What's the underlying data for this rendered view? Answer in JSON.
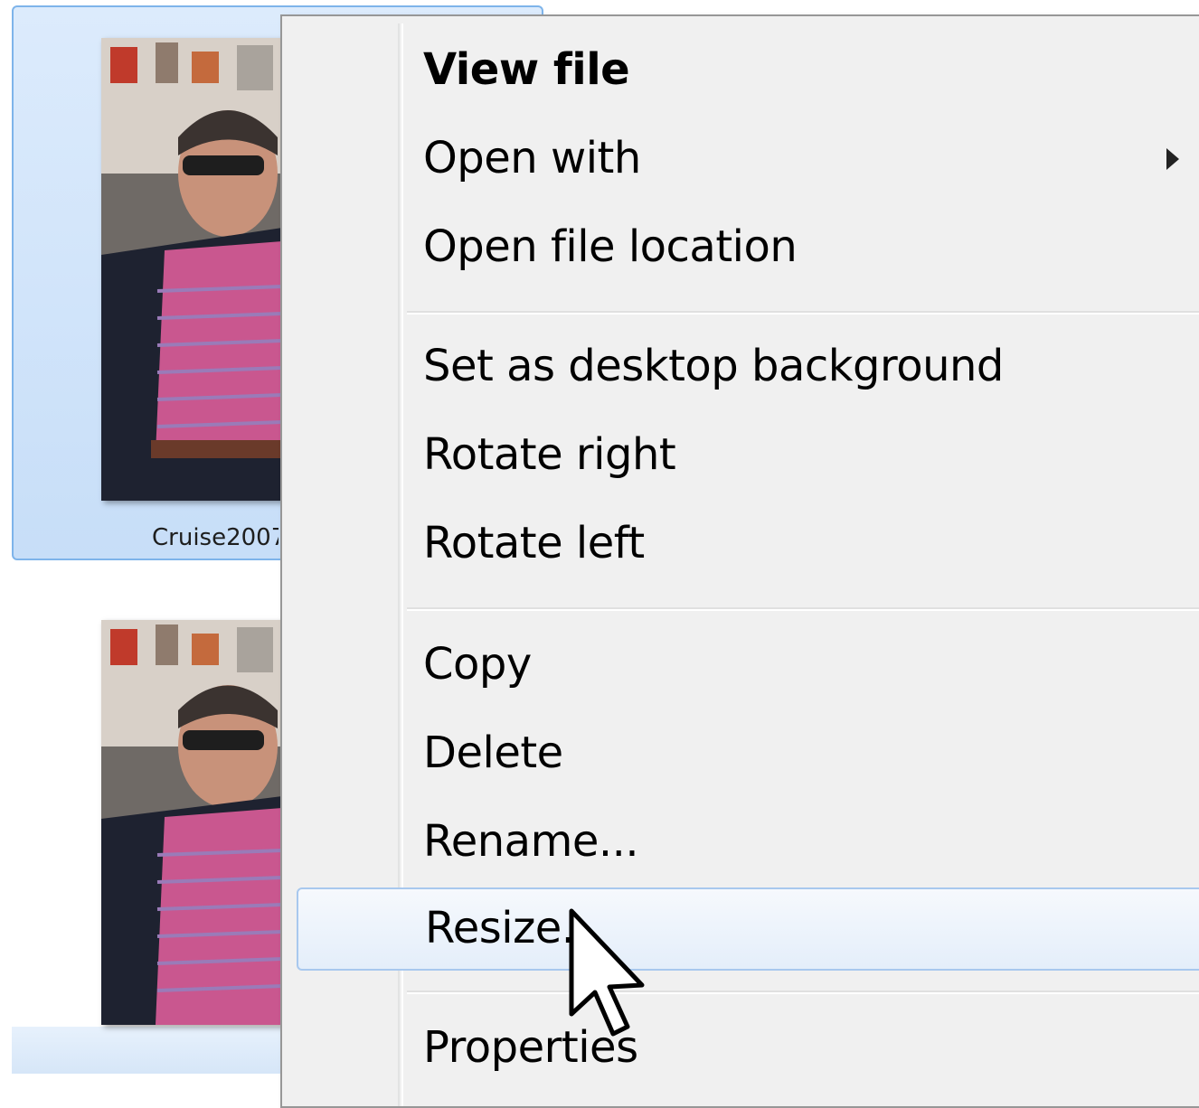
{
  "explorer": {
    "files": [
      {
        "caption": "Cruise2007",
        "selected": true
      },
      {
        "caption": "",
        "selected": false
      }
    ]
  },
  "context_menu": {
    "groups": [
      [
        {
          "label": "View file",
          "default": true
        },
        {
          "label": "Open with",
          "has_submenu": true
        },
        {
          "label": "Open file location"
        }
      ],
      [
        {
          "label": "Set as desktop background"
        },
        {
          "label": "Rotate right"
        },
        {
          "label": "Rotate left"
        }
      ],
      [
        {
          "label": "Copy"
        },
        {
          "label": "Delete"
        },
        {
          "label": "Rename..."
        },
        {
          "label": "Resize...",
          "hovered": true
        }
      ],
      [
        {
          "label": "Properties"
        }
      ]
    ]
  },
  "colors": {
    "menu_background": "#f0f0f0",
    "hover_border": "#a8c8ee",
    "selection_fill": "#c7def8",
    "selection_border": "#7eb4ea"
  }
}
